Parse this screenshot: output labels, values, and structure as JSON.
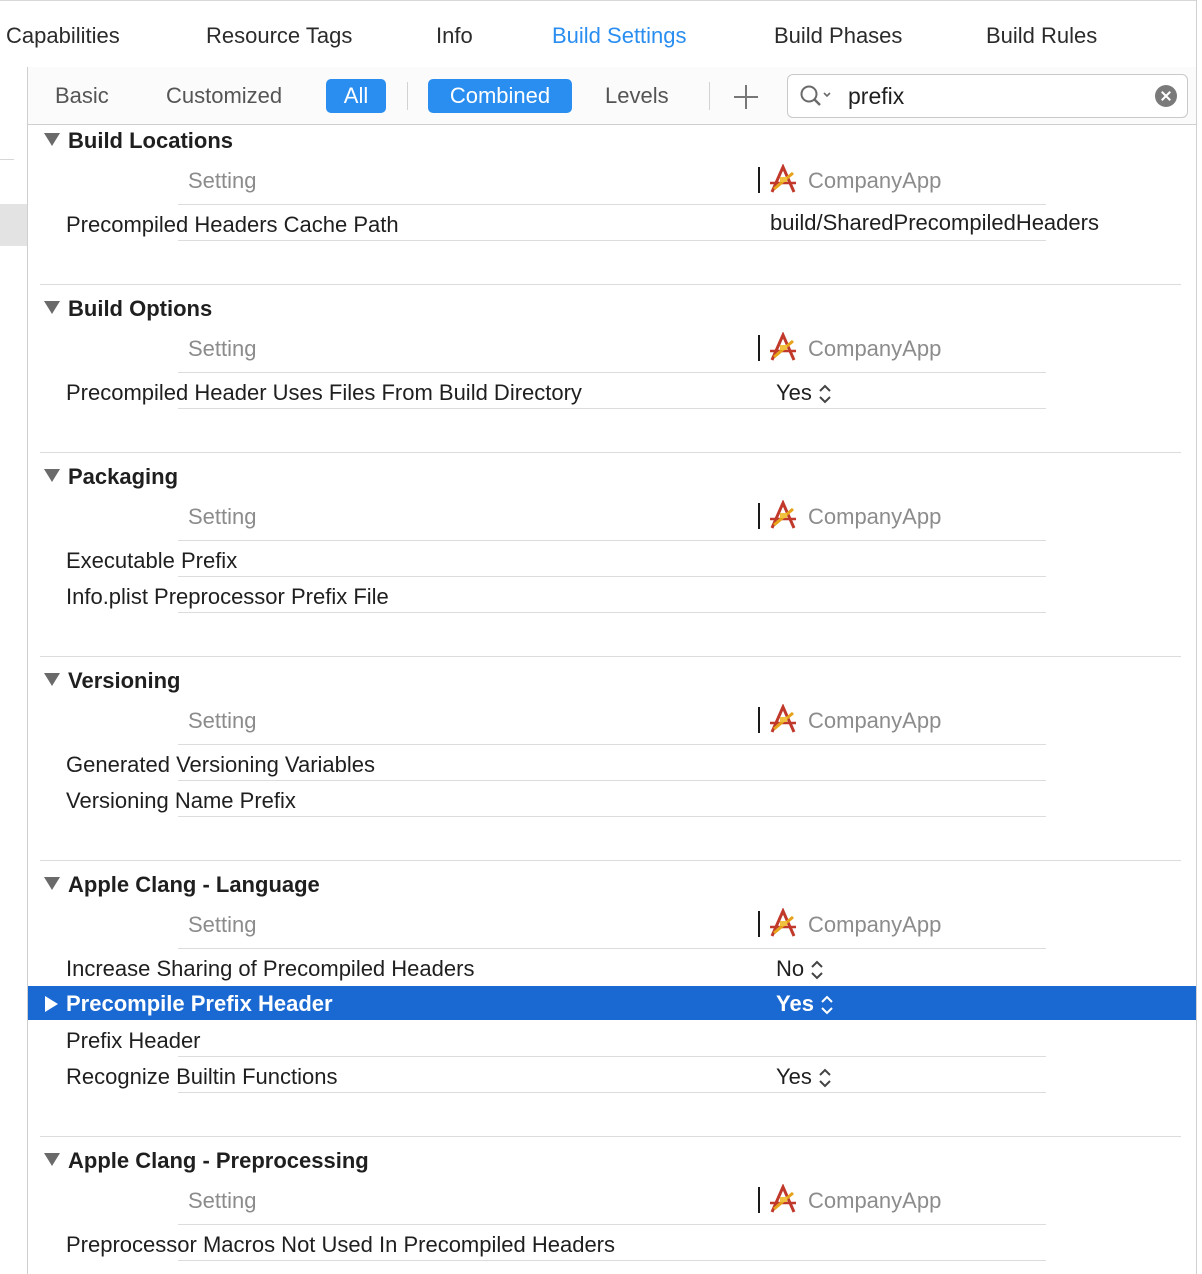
{
  "top_tabs": {
    "capabilities": "Capabilities",
    "resource_tags": "Resource Tags",
    "info": "Info",
    "build_settings": "Build Settings",
    "build_phases": "Build Phases",
    "build_rules": "Build Rules"
  },
  "filter_bar": {
    "basic": "Basic",
    "customized": "Customized",
    "all": "All",
    "combined": "Combined",
    "levels": "Levels",
    "search_value": "prefix"
  },
  "columns": {
    "setting": "Setting",
    "target": "CompanyApp"
  },
  "sections": {
    "build_locations": {
      "title": "Build Locations",
      "rows": [
        {
          "label": "Precompiled Headers Cache Path",
          "value": "build/SharedPrecompiledHeaders"
        }
      ]
    },
    "build_options": {
      "title": "Build Options",
      "rows": [
        {
          "label": "Precompiled Header Uses Files From Build Directory",
          "value": "Yes"
        }
      ]
    },
    "packaging": {
      "title": "Packaging",
      "rows": [
        {
          "label": "Executable Prefix",
          "value": ""
        },
        {
          "label": "Info.plist Preprocessor Prefix File",
          "value": ""
        }
      ]
    },
    "versioning": {
      "title": "Versioning",
      "rows": [
        {
          "label": "Generated Versioning Variables",
          "value": ""
        },
        {
          "label": "Versioning Name Prefix",
          "value": ""
        }
      ]
    },
    "clang_language": {
      "title": "Apple Clang - Language",
      "rows": [
        {
          "label": "Increase Sharing of Precompiled Headers",
          "value": "No"
        },
        {
          "label": "Precompile Prefix Header",
          "value": "Yes",
          "selected": true
        },
        {
          "label": "Prefix Header",
          "value": ""
        },
        {
          "label": "Recognize Builtin Functions",
          "value": "Yes"
        }
      ]
    },
    "clang_preprocessing": {
      "title": "Apple Clang - Preprocessing",
      "rows": [
        {
          "label": "Preprocessor Macros Not Used In Precompiled Headers",
          "value": ""
        }
      ]
    }
  },
  "colors": {
    "accent": "#2a8ef0",
    "selection": "#1a69d2"
  },
  "icons": [
    "magnifier-icon",
    "clear-icon",
    "plus-icon",
    "disclosure-triangle-icon",
    "app-target-icon",
    "up-down-arrows-icon"
  ]
}
